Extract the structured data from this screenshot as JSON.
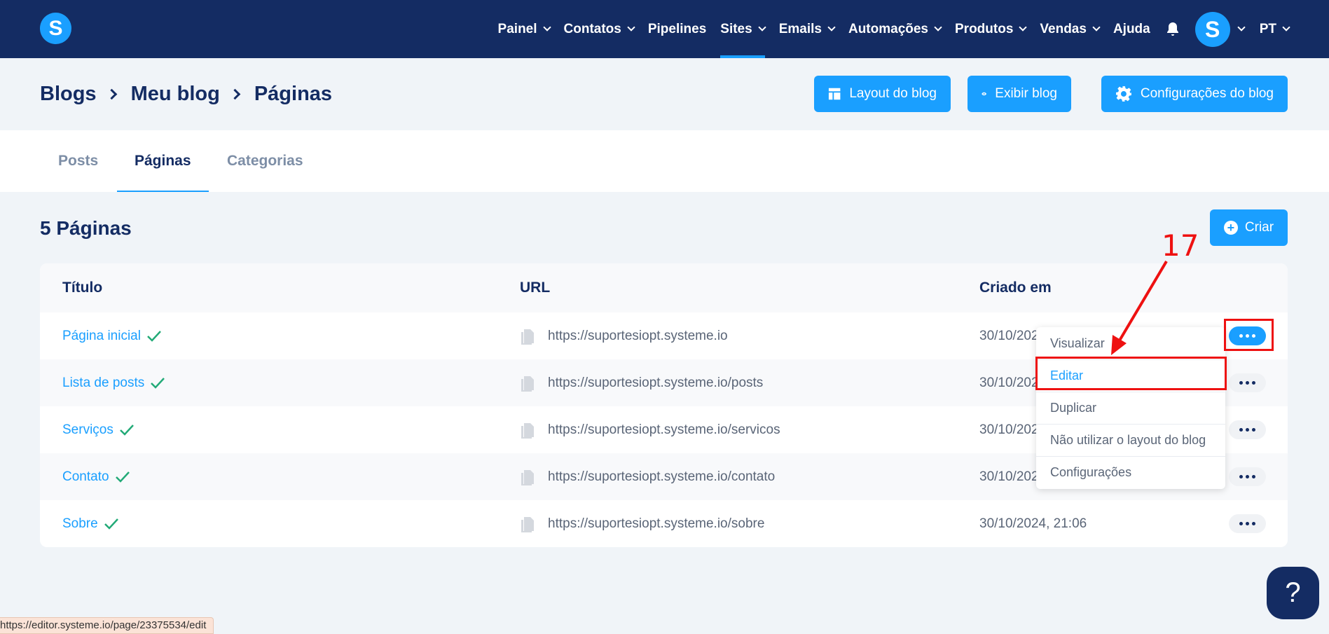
{
  "nav": {
    "items": [
      {
        "label": "Painel",
        "has_menu": true
      },
      {
        "label": "Contatos",
        "has_menu": true
      },
      {
        "label": "Pipelines",
        "has_menu": false
      },
      {
        "label": "Sites",
        "has_menu": true,
        "active": true
      },
      {
        "label": "Emails",
        "has_menu": true
      },
      {
        "label": "Automações",
        "has_menu": true
      },
      {
        "label": "Produtos",
        "has_menu": true
      },
      {
        "label": "Vendas",
        "has_menu": true
      },
      {
        "label": "Ajuda",
        "has_menu": false
      }
    ],
    "logo_letter": "S",
    "avatar_letter": "S",
    "language": "PT"
  },
  "breadcrumb": [
    "Blogs",
    "Meu blog",
    "Páginas"
  ],
  "header_buttons": {
    "layout": "Layout do blog",
    "view": "Exibir blog",
    "settings": "Configurações do blog"
  },
  "tabs": [
    "Posts",
    "Páginas",
    "Categorias"
  ],
  "section_title": "5 Páginas",
  "create_label": "Criar",
  "table": {
    "headers": {
      "title": "Título",
      "url": "URL",
      "created": "Criado em"
    },
    "rows": [
      {
        "title": "Página inicial",
        "url": "https://suportesiopt.systeme.io",
        "date": "30/10/2024, 21:06"
      },
      {
        "title": "Lista de posts",
        "url": "https://suportesiopt.systeme.io/posts",
        "date": "30/10/2024, 21:06"
      },
      {
        "title": "Serviços",
        "url": "https://suportesiopt.systeme.io/servicos",
        "date": "30/10/2024, 21:06"
      },
      {
        "title": "Contato",
        "url": "https://suportesiopt.systeme.io/contato",
        "date": "30/10/2024, 21:06"
      },
      {
        "title": "Sobre",
        "url": "https://suportesiopt.systeme.io/sobre",
        "date": "30/10/2024, 21:06"
      }
    ]
  },
  "dropdown": [
    "Visualizar",
    "Editar",
    "Duplicar",
    "Não utilizar o layout do blog",
    "Configurações"
  ],
  "annotation": {
    "step": "17"
  },
  "status_url": "https://editor.systeme.io/page/23375534/edit",
  "help_symbol": "?",
  "colors": {
    "navy": "#142c63",
    "accent": "#1a9fff",
    "annotation": "#ee1111",
    "check": "#22aa77"
  }
}
